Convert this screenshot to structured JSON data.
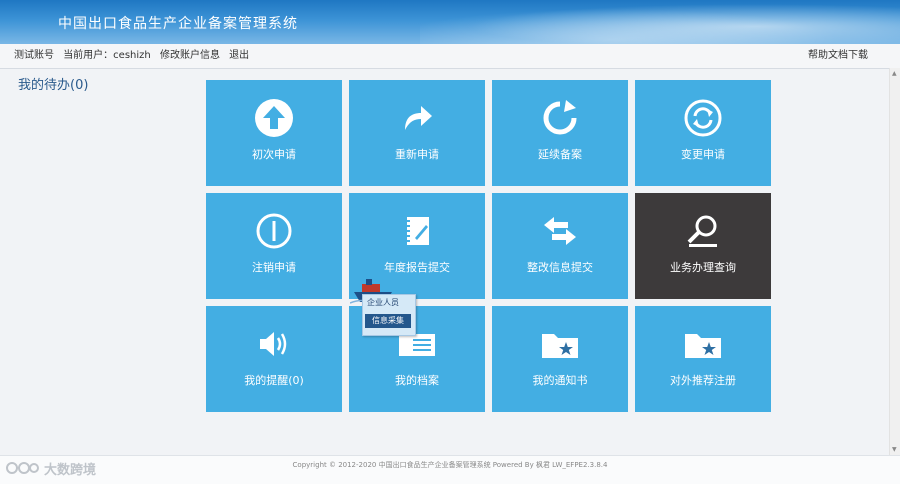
{
  "header": {
    "title": "中国出口食品生产企业备案管理系统"
  },
  "topbar": {
    "account": "测试账号",
    "current_user": "当前用户：ceshizh",
    "edit_account": "修改账户信息",
    "logout": "退出",
    "help": "帮助文档下载"
  },
  "todo": {
    "label": "我的待办(0)"
  },
  "tiles": [
    {
      "label": "初次申请",
      "icon": "arrow-up-circle-icon"
    },
    {
      "label": "重新申请",
      "icon": "redo-arrow-icon"
    },
    {
      "label": "延续备案",
      "icon": "refresh-icon"
    },
    {
      "label": "变更申请",
      "icon": "sync-circle-icon"
    },
    {
      "label": "注销申请",
      "icon": "power-icon"
    },
    {
      "label": "年度报告提交",
      "icon": "notebook-icon"
    },
    {
      "label": "整改信息提交",
      "icon": "exchange-arrows-icon"
    },
    {
      "label": "业务办理查询",
      "icon": "magnifier-icon"
    },
    {
      "label": "我的提醒(0)",
      "icon": "speaker-icon"
    },
    {
      "label": "我的档案",
      "icon": "id-card-icon"
    },
    {
      "label": "我的通知书",
      "icon": "folder-star-icon"
    },
    {
      "label": "对外推荐注册",
      "icon": "folder-star-icon"
    }
  ],
  "popup": {
    "line1": "企业人员",
    "line2": "信息采集"
  },
  "footer": {
    "copyright": "Copyright © 2012-2020 中国出口食品生产企业备案管理系统 Powered By 枫君 LW_EFPE2.3.8.4"
  },
  "watermark": {
    "text": "大数跨境"
  },
  "colors": {
    "tile": "#43aee3",
    "tile_dark": "#3d3a3b",
    "header": "#2e86cf"
  }
}
